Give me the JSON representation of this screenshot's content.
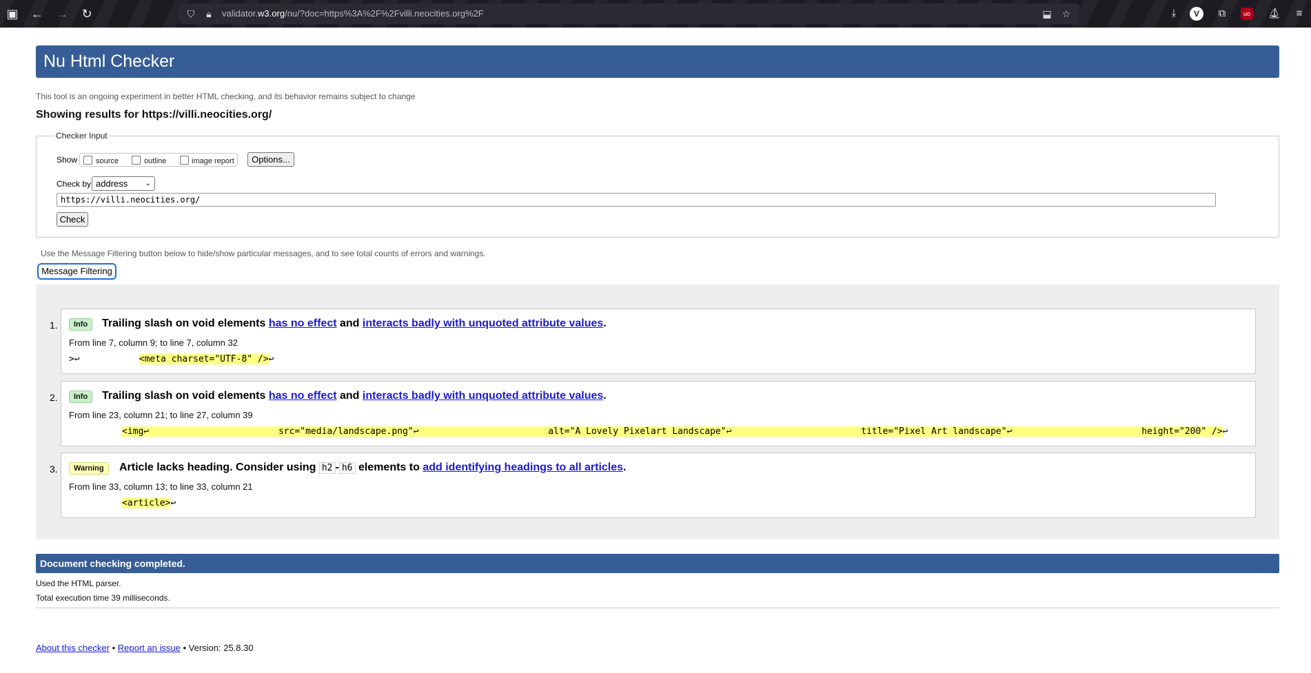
{
  "browser": {
    "url_prefix": "validator.",
    "url_domain": "w3.org",
    "url_path": "/nu/?doc=https%3A%2F%2Fvilli.neocities.org%2F",
    "profile_letter": "V"
  },
  "page": {
    "title": "Nu Html Checker",
    "experiment_note": "This tool is an ongoing experiment in better HTML checking, and its behavior remains subject to change",
    "showing_results": "Showing results for https://villi.neocities.org/"
  },
  "checker_input": {
    "legend": "Checker Input",
    "show_label": "Show",
    "options": [
      "source",
      "outline",
      "image report"
    ],
    "options_button": "Options...",
    "check_by_label": "Check by",
    "check_by_value": "address",
    "url_value": "https://villi.neocities.org/",
    "check_button": "Check"
  },
  "filtering": {
    "note": "Use the Message Filtering button below to hide/show particular messages, and to see total counts of errors and warnings.",
    "button": "Message Filtering"
  },
  "messages": [
    {
      "number": "1.",
      "type": "Info",
      "title_prefix": "Trailing slash on void elements",
      "link1": "has no effect",
      "middle": "and",
      "link2": "interacts badly with unquoted attribute values",
      "suffix": ".",
      "location": "From line 7, column 9; to line 7, column 32",
      "code_before": ">↩           ",
      "code_highlight": "<meta charset=\"UTF-8\" />",
      "code_after": "↩"
    },
    {
      "number": "2.",
      "type": "Info",
      "title_prefix": "Trailing slash on void elements",
      "link1": "has no effect",
      "middle": "and",
      "link2": "interacts badly with unquoted attribute values",
      "suffix": ".",
      "location": "From line 23, column 21; to line 27, column 39",
      "code_before": "",
      "code_highlight": "<img↩                        src=\"media/landscape.png\"↩                        alt=\"A Lovely Pixelart Landscape\"↩                        title=\"Pixel Art landscape\"↩                        height=\"200\" />",
      "code_after": "↩"
    },
    {
      "number": "3.",
      "type": "Warning",
      "title_prefix": "Article lacks heading. Consider using",
      "code_token_1": "h2",
      "dash": "-",
      "code_token_2": "h6",
      "middle": "elements to",
      "link1": "add identifying headings to all articles",
      "suffix": ".",
      "location": "From line 33, column 13; to line 33, column 21",
      "code_before": "",
      "code_highlight": "<article>",
      "code_after": "↩"
    }
  ],
  "summary": {
    "completed": "Document checking completed.",
    "parser": "Used the HTML parser.",
    "execution_time": "Total execution time 39 milliseconds."
  },
  "footer": {
    "about_link": "About this checker",
    "sep1": "•",
    "report_link": "Report an issue",
    "sep2": "•",
    "version": "Version: 25.8.30"
  },
  "colors": {
    "header_blue": "#365d95",
    "info_badge": "#c8f0c8",
    "warning_badge": "#ffffb8",
    "code_highlight": "#ffff80",
    "link": "#1a1ad6"
  },
  "icons": [
    "sidebar-icon",
    "back-icon",
    "forward-icon",
    "reload-icon",
    "shield-icon",
    "lock-icon",
    "save-page-icon",
    "bookmark-star-icon",
    "download-icon",
    "profile-icon",
    "extensions-icon",
    "ublock-icon",
    "extension-icon",
    "menu-icon"
  ]
}
